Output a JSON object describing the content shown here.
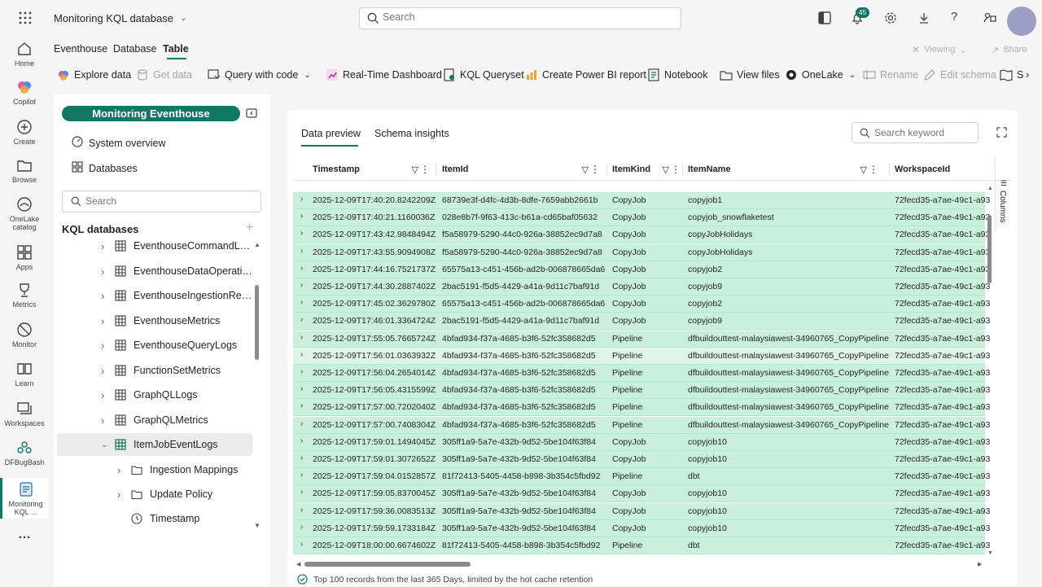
{
  "header": {
    "title": "Monitoring KQL database",
    "search_placeholder": "Search",
    "notif_count": "45"
  },
  "rail": [
    {
      "label": "Home",
      "icon": "home-icon"
    },
    {
      "label": "Copilot",
      "icon": "copilot-icon"
    },
    {
      "label": "Create",
      "icon": "create-icon"
    },
    {
      "label": "Browse",
      "icon": "browse-icon"
    },
    {
      "label": "OneLake catalog",
      "icon": "onelake-icon"
    },
    {
      "label": "Apps",
      "icon": "apps-icon"
    },
    {
      "label": "Metrics",
      "icon": "metrics-icon"
    },
    {
      "label": "Monitor",
      "icon": "monitor-icon"
    },
    {
      "label": "Learn",
      "icon": "learn-icon"
    },
    {
      "label": "Workspaces",
      "icon": "workspaces-icon"
    },
    {
      "label": "DFBugBash",
      "icon": "dfbugbash-icon"
    },
    {
      "label": "Monitoring KQL ...",
      "icon": "kql-icon"
    }
  ],
  "tabs": [
    "Eventhouse",
    "Database",
    "Table"
  ],
  "top_actions": {
    "viewing": "Viewing",
    "share": "Share"
  },
  "toolbar": [
    "Explore data",
    "Get data",
    "Query with code",
    "Real-Time Dashboard",
    "KQL Queryset",
    "Create Power BI report",
    "Notebook",
    "View files",
    "OneLake",
    "Rename",
    "Edit schema",
    "S"
  ],
  "left": {
    "eventhouse": "Monitoring Eventhouse",
    "system_overview": "System overview",
    "databases": "Databases",
    "search_placeholder": "Search",
    "section": "KQL databases",
    "tree": [
      "EventhouseCommandLogs",
      "EventhouseDataOperatio...",
      "EventhouseIngestionResu...",
      "EventhouseMetrics",
      "EventhouseQueryLogs",
      "FunctionSetMetrics",
      "GraphQLLogs",
      "GraphQLMetrics",
      "ItemJobEventLogs",
      "Ingestion Mappings",
      "Update Policy",
      "Timestamp"
    ]
  },
  "preview": {
    "tab_data": "Data preview",
    "tab_schema": "Schema insights",
    "search_placeholder": "Search keyword",
    "columns_label": "Columns",
    "headers": [
      "Timestamp",
      "ItemId",
      "ItemKind",
      "ItemName",
      "WorkspaceId"
    ],
    "rows": [
      [
        "2025-12-09T17:40:20.8242209Z",
        "68739e3f-d4fc-4d3b-8dfe-7659abb2661b",
        "CopyJob",
        "copyjob1",
        "72fecd35-a7ae-49c1-a93"
      ],
      [
        "2025-12-09T17:40:21.1160036Z",
        "028e8b7f-9f63-413c-b61a-cd65baf05632",
        "CopyJob",
        "copyjob_snowflaketest",
        "72fecd35-a7ae-49c1-a93"
      ],
      [
        "2025-12-09T17:43:42.9848494Z",
        "f5a58979-5290-44c0-926a-38852ec9d7a8",
        "CopyJob",
        "copyJobHolidays",
        "72fecd35-a7ae-49c1-a93"
      ],
      [
        "2025-12-09T17:43:55.9094908Z",
        "f5a58979-5290-44c0-926a-38852ec9d7a8",
        "CopyJob",
        "copyJobHolidays",
        "72fecd35-a7ae-49c1-a93"
      ],
      [
        "2025-12-09T17:44:16.7521737Z",
        "65575a13-c451-456b-ad2b-006878665da6",
        "CopyJob",
        "copyjob2",
        "72fecd35-a7ae-49c1-a93"
      ],
      [
        "2025-12-09T17:44:30.2887402Z",
        "2bac5191-f5d5-4429-a41a-9d11c7baf91d",
        "CopyJob",
        "copyjob9",
        "72fecd35-a7ae-49c1-a93"
      ],
      [
        "2025-12-09T17:45:02.3629780Z",
        "65575a13-c451-456b-ad2b-006878665da6",
        "CopyJob",
        "copyjob2",
        "72fecd35-a7ae-49c1-a93"
      ],
      [
        "2025-12-09T17:46:01.3364724Z",
        "2bac5191-f5d5-4429-a41a-9d11c7baf91d",
        "CopyJob",
        "copyjob9",
        "72fecd35-a7ae-49c1-a93"
      ],
      [
        "2025-12-09T17:55:05.7665724Z",
        "4bfad934-f37a-4685-b3f6-52fc358682d5",
        "Pipeline",
        "dfbuildouttest-malaysiawest-34960765_CopyPipeline",
        "72fecd35-a7ae-49c1-a93"
      ],
      [
        "2025-12-09T17:56:01.0363932Z",
        "4bfad934-f37a-4685-b3f6-52fc358682d5",
        "Pipeline",
        "dfbuildouttest-malaysiawest-34960765_CopyPipeline",
        "72fecd35-a7ae-49c1-a93"
      ],
      [
        "2025-12-09T17:56:04.2654014Z",
        "4bfad934-f37a-4685-b3f6-52fc358682d5",
        "Pipeline",
        "dfbuildouttest-malaysiawest-34960765_CopyPipeline",
        "72fecd35-a7ae-49c1-a93"
      ],
      [
        "2025-12-09T17:56:05.4315599Z",
        "4bfad934-f37a-4685-b3f6-52fc358682d5",
        "Pipeline",
        "dfbuildouttest-malaysiawest-34960765_CopyPipeline",
        "72fecd35-a7ae-49c1-a93"
      ],
      [
        "2025-12-09T17:57:00.7202040Z",
        "4bfad934-f37a-4685-b3f6-52fc358682d5",
        "Pipeline",
        "dfbuildouttest-malaysiawest-34960765_CopyPipeline",
        "72fecd35-a7ae-49c1-a93"
      ],
      [
        "2025-12-09T17:57:00.7408304Z",
        "4bfad934-f37a-4685-b3f6-52fc358682d5",
        "Pipeline",
        "dfbuildouttest-malaysiawest-34960765_CopyPipeline",
        "72fecd35-a7ae-49c1-a93"
      ],
      [
        "2025-12-09T17:59:01.1494045Z",
        "305ff1a9-5a7e-432b-9d52-5be104f63f84",
        "CopyJob",
        "copyjob10",
        "72fecd35-a7ae-49c1-a93"
      ],
      [
        "2025-12-09T17:59:01.3072652Z",
        "305ff1a9-5a7e-432b-9d52-5be104f63f84",
        "CopyJob",
        "copyjob10",
        "72fecd35-a7ae-49c1-a93"
      ],
      [
        "2025-12-09T17:59:04.0152857Z",
        "81f72413-5405-4458-b898-3b354c5fbd92",
        "Pipeline",
        "dbt",
        "72fecd35-a7ae-49c1-a93"
      ],
      [
        "2025-12-09T17:59:05.8370045Z",
        "305ff1a9-5a7e-432b-9d52-5be104f63f84",
        "CopyJob",
        "copyjob10",
        "72fecd35-a7ae-49c1-a93"
      ],
      [
        "2025-12-09T17:59:36.0083513Z",
        "305ff1a9-5a7e-432b-9d52-5be104f63f84",
        "CopyJob",
        "copyjob10",
        "72fecd35-a7ae-49c1-a93"
      ],
      [
        "2025-12-09T17:59:59.1733184Z",
        "305ff1a9-5a7e-432b-9d52-5be104f63f84",
        "CopyJob",
        "copyjob10",
        "72fecd35-a7ae-49c1-a93"
      ],
      [
        "2025-12-09T18:00:00.6674602Z",
        "81f72413-5405-4458-b898-3b354c5fbd92",
        "Pipeline",
        "dbt",
        "72fecd35-a7ae-49c1-a93"
      ]
    ],
    "status": "Top 100 records from the last 365 Days, limited by the hot cache retention"
  },
  "colors": {
    "accent": "#117865",
    "row": "#c9f0dc",
    "row_highlight": "#ddf6e8"
  }
}
